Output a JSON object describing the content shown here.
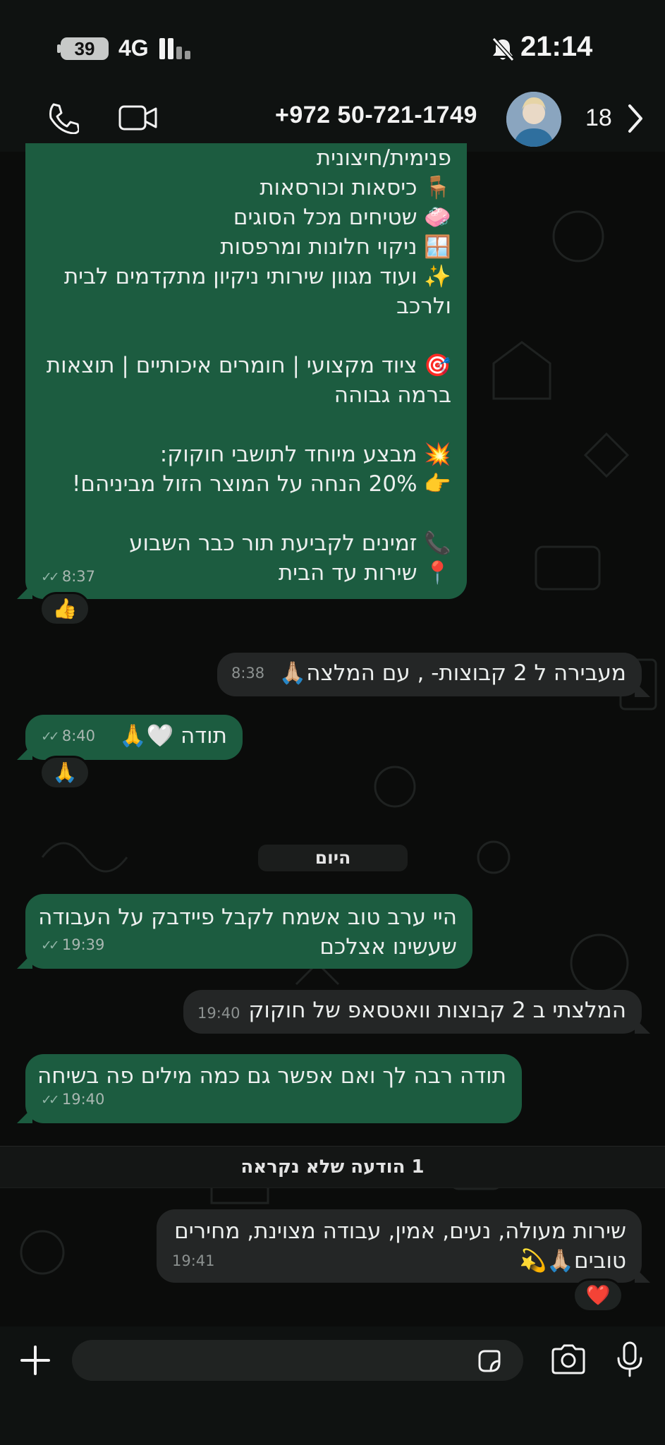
{
  "status": {
    "battery": "39",
    "network": "4G",
    "time": "21:14"
  },
  "header": {
    "contact": "+972 50-721-1749",
    "unread": "18"
  },
  "messages": {
    "m1": {
      "lines": [
        "פנימית/חיצונית",
        "🪑 כיסאות וכורסאות",
        "🧼 שטיחים מכל הסוגים",
        "🪟 ניקוי חלונות ומרפסות",
        "✨ ועוד מגוון שירותי ניקיון מתקדמים לבית",
        "ולרכב",
        "",
        "🎯 ציוד מקצועי | חומרים איכותיים | תוצאות",
        "ברמה גבוהה",
        "",
        "💥 מבצע מיוחד לתושבי חוקוק:",
        "👉 20% הנחה על המוצר הזול מביניהם!",
        "",
        "📞 זמינים לקביעת תור כבר השבוע",
        "📍 שירות עד הבית"
      ],
      "time": "8:37",
      "reaction": "👍"
    },
    "m2": {
      "text": "מעבירה ל 2 קבוצות- , עם המלצה🙏🏼",
      "time": "8:38"
    },
    "m3": {
      "text": "תודה 🤍🙏",
      "time": "8:40",
      "reaction": "🙏"
    },
    "m4": {
      "lines": [
        "היי ערב טוב אשמח לקבל פיידבק על העבודה",
        "שעשינו אצלכם"
      ],
      "time": "19:39"
    },
    "m5": {
      "text": "המלצתי ב 2 קבוצות וואטסאפ של חוקוק",
      "time": "19:40"
    },
    "m6": {
      "text": "תודה רבה לך ואם אפשר גם כמה מילים פה בשיחה",
      "time": "19:40"
    },
    "m7": {
      "lines": [
        "שירות מעולה, נעים, אמין, עבודה מצוינת, מחירים",
        "טובים🙏🏼💫"
      ],
      "time": "19:41",
      "reaction": "❤️"
    }
  },
  "day_separator": "היום",
  "unread_banner": "1 הודעה שלא נקראה",
  "icons": {
    "call": "phone-icon",
    "video": "video-camera-icon",
    "back": "chevron-right-icon",
    "mute": "bell-off-icon",
    "attach": "plus-icon",
    "sticker": "sticker-icon",
    "camera": "camera-icon",
    "mic": "microphone-icon"
  },
  "colors": {
    "incoming_bubble": "#1c5c40",
    "outgoing_bubble": "#242626",
    "background": "#0b0c0b"
  }
}
